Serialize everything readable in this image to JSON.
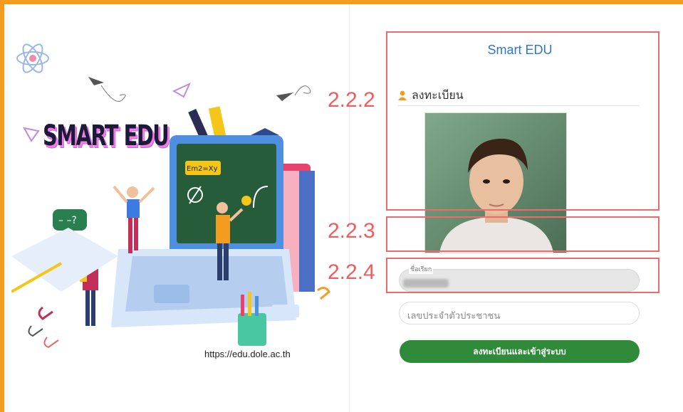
{
  "illustration": {
    "logo_text": "SMART EDU",
    "board_text": "Em2=Xy",
    "url": "https://edu.dole.ac.th"
  },
  "panel": {
    "title": "Smart EDU",
    "register_header": "ลงทะเบียน"
  },
  "form": {
    "name_caption": "ชื่อเรียก",
    "id_placeholder": "เลขประจำตัวประชาชน",
    "submit_label": "ลงทะเบียนและเข้าสู่ระบบ"
  },
  "annotations": {
    "a1": "2.2.2",
    "a2": "2.2.3",
    "a3": "2.2.4"
  },
  "colors": {
    "frame": "#f39c1f",
    "title": "#2f77c0",
    "button": "#2f8a3a",
    "annotation": "#ef6b6b",
    "user_icon": "#f39c1f"
  }
}
